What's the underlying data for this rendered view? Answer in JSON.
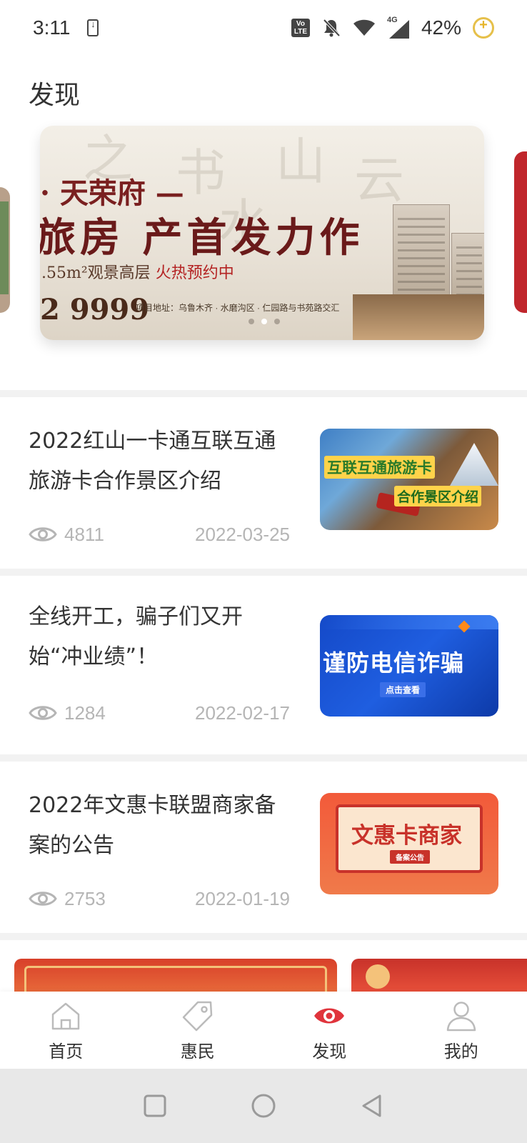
{
  "status_bar": {
    "time": "3:11",
    "volte": "Vo LTE",
    "network": "4G",
    "battery": "42%"
  },
  "page_title": "发现",
  "banner": {
    "title": "· 天荣府 —",
    "headline": "旅房 产首发力作",
    "area": ".55m²",
    "sub": "观景高层",
    "hot": "火热预约中",
    "price": "2 9999",
    "address": "项目地址：乌鲁木齐 · 水磨沟区 · 仁园路与书苑路交汇",
    "slide_count": 3,
    "active_slide": 1
  },
  "articles": [
    {
      "title": "2022红山一卡通互联互通旅游卡合作景区介绍",
      "views": "4811",
      "date": "2022-03-25",
      "thumb": {
        "line1": "互联互通旅游卡",
        "line2": "合作景区介绍"
      }
    },
    {
      "title": "全线开工，骗子们又开始“冲业绩”！",
      "views": "1284",
      "date": "2022-02-17",
      "thumb": {
        "line1": "谨防电信诈骗",
        "line2": "点击查看"
      }
    },
    {
      "title": "2022年文惠卡联盟商家备案的公告",
      "views": "2753",
      "date": "2022-01-19",
      "thumb": {
        "line1": "文惠卡商家",
        "line2": "备案公告"
      }
    }
  ],
  "tabbar": {
    "items": [
      {
        "label": "首页",
        "icon": "home-icon"
      },
      {
        "label": "惠民",
        "icon": "tag-icon"
      },
      {
        "label": "发现",
        "icon": "eye-icon",
        "active": true
      },
      {
        "label": "我的",
        "icon": "person-icon"
      }
    ],
    "active_color": "#e0343c",
    "inactive_color": "#bbbbbb"
  },
  "navbar": {
    "buttons": [
      "recents-icon",
      "home-circle-icon",
      "back-triangle-icon"
    ]
  },
  "colors": {
    "accent": "#e0343c",
    "meta_gray": "#b5b5b5",
    "nav_bg": "#e8e8e8"
  }
}
